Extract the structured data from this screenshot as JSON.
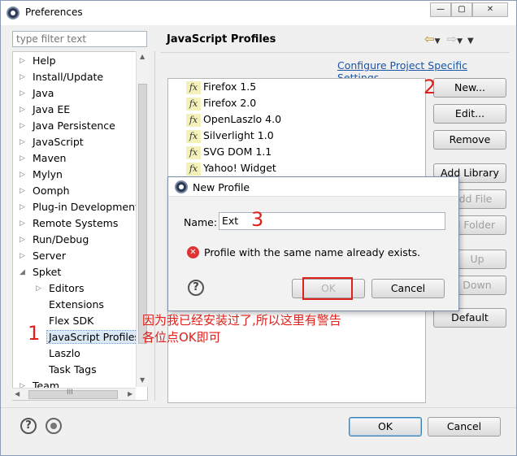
{
  "window": {
    "title": "Preferences"
  },
  "filter": {
    "placeholder": "type filter text"
  },
  "tree": {
    "items": [
      {
        "label": "Help"
      },
      {
        "label": "Install/Update"
      },
      {
        "label": "Java"
      },
      {
        "label": "Java EE"
      },
      {
        "label": "Java Persistence"
      },
      {
        "label": "JavaScript"
      },
      {
        "label": "Maven"
      },
      {
        "label": "Mylyn"
      },
      {
        "label": "Oomph"
      },
      {
        "label": "Plug-in Development"
      },
      {
        "label": "Remote Systems"
      },
      {
        "label": "Run/Debug"
      },
      {
        "label": "Server"
      },
      {
        "label": "Spket"
      },
      {
        "label": "Editors"
      },
      {
        "label": "Extensions"
      },
      {
        "label": "Flex SDK"
      },
      {
        "label": "JavaScript Profiles",
        "selected": true
      },
      {
        "label": "Laszlo"
      },
      {
        "label": "Task Tags"
      },
      {
        "label": "Team"
      }
    ],
    "hscroll_glyph": "III"
  },
  "page": {
    "title": "JavaScript Profiles",
    "config_link": "Configure Project Specific Settings...",
    "profiles": [
      "Firefox 1.5",
      "Firefox 2.0",
      "OpenLaszlo 4.0",
      "Silverlight 1.0",
      "SVG DOM 1.1",
      "Yahoo! Widget"
    ],
    "fx_glyph": "fx",
    "buttons": {
      "new": "New...",
      "edit": "Edit...",
      "remove": "Remove",
      "add_library": "Add Library",
      "add_file": "dd File",
      "add_folder": "l Folder",
      "up": "Up",
      "down": "Down",
      "default": "Default"
    }
  },
  "dialog": {
    "title": "New Profile",
    "name_label": "Name:",
    "name_value": "Ext",
    "error_text": "Profile with the same name already exists.",
    "ok": "OK",
    "cancel": "Cancel"
  },
  "annotations": {
    "num1": "1",
    "num2": "2",
    "num3": "3",
    "note_line1": "因为我已经安装过了,所以这里有警告",
    "note_line2": "各位点OK即可"
  },
  "footer": {
    "ok": "OK",
    "cancel": "Cancel"
  }
}
